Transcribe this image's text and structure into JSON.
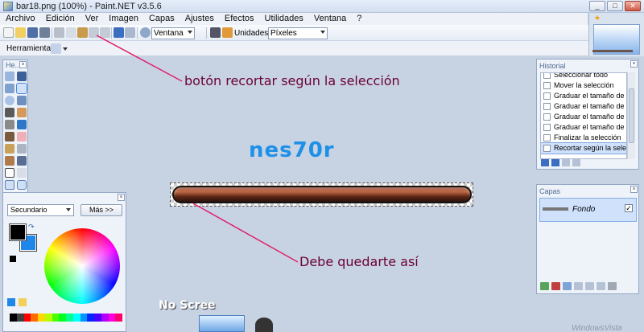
{
  "window": {
    "title": "bar18.png (100%) - Paint.NET v3.5.6",
    "min_label": "_",
    "max_label": "□",
    "close_label": "✕"
  },
  "menu": [
    "Archivo",
    "Edición",
    "Ver",
    "Imagen",
    "Capas",
    "Ajustes",
    "Efectos",
    "Utilidades",
    "Ventana",
    "?"
  ],
  "toolbar": {
    "zoom_mode": "Ventana",
    "units_label": "Unidades:",
    "units_value": "Píxeles"
  },
  "toolbar2": {
    "tool_label": "Herramienta:"
  },
  "tools_panel": {
    "title": "He..."
  },
  "history_panel": {
    "title": "Historial",
    "items": [
      "Seleccionar todo",
      "Mover la selección",
      "Graduar el tamaño de ...",
      "Graduar el tamaño de ...",
      "Graduar el tamaño de ...",
      "Graduar el tamaño de ...",
      "Finalizar la selección",
      "Recortar según la sele..."
    ],
    "selected_index": 7
  },
  "layers_panel": {
    "title": "Capas",
    "layer_name": "Fondo",
    "layer_visible": "✓"
  },
  "colors_panel": {
    "mode": "Secundario",
    "more_button": "Más >>",
    "primary_color": "#000000",
    "secondary_color": "#1f87ea"
  },
  "canvas": {
    "watermark": "nes70r",
    "annotation_top": "botón recortar según la selección",
    "annotation_bottom": "Debe quedarte así"
  },
  "desktop": {
    "no_screen_label": "No Scree",
    "watermark_right": "WindowsVista"
  }
}
